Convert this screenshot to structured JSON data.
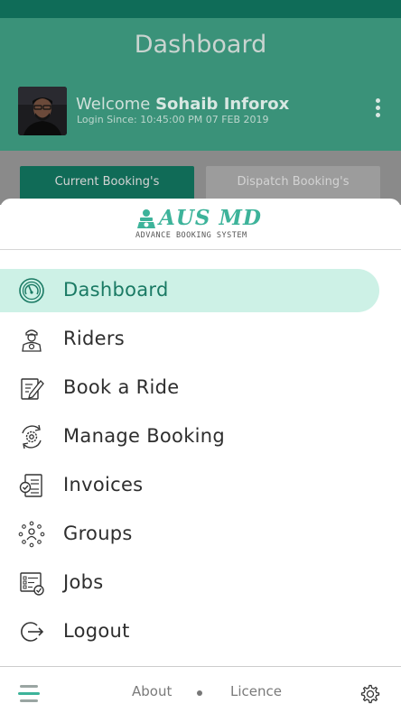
{
  "header": {
    "title": "Dashboard",
    "welcome_prefix": "Welcome",
    "user_name": "Sohaib Inforox",
    "login_since": "Login Since: 10:45:00 PM 07 FEB 2019"
  },
  "tabs": {
    "current": "Current Booking's",
    "dispatch": "Dispatch Booking's"
  },
  "logo": {
    "brand": "AUS MD",
    "subtitle": "ADVANCE BOOKING SYSTEM"
  },
  "menu": {
    "items": [
      {
        "label": "Dashboard",
        "icon": "dashboard-gauge-icon",
        "active": true
      },
      {
        "label": "Riders",
        "icon": "rider-icon",
        "active": false
      },
      {
        "label": "Book a Ride",
        "icon": "edit-document-icon",
        "active": false
      },
      {
        "label": "Manage Booking",
        "icon": "gear-cycle-icon",
        "active": false
      },
      {
        "label": "Invoices",
        "icon": "invoice-check-icon",
        "active": false
      },
      {
        "label": "Groups",
        "icon": "group-network-icon",
        "active": false
      },
      {
        "label": "Jobs",
        "icon": "checklist-icon",
        "active": false
      },
      {
        "label": "Logout",
        "icon": "logout-icon",
        "active": false
      }
    ]
  },
  "footer": {
    "about": "About",
    "licence": "Licence"
  },
  "colors": {
    "primary": "#3a9279",
    "primary_dark": "#106b57",
    "accent": "#3db39a",
    "active_bg": "#cdf1e6"
  }
}
